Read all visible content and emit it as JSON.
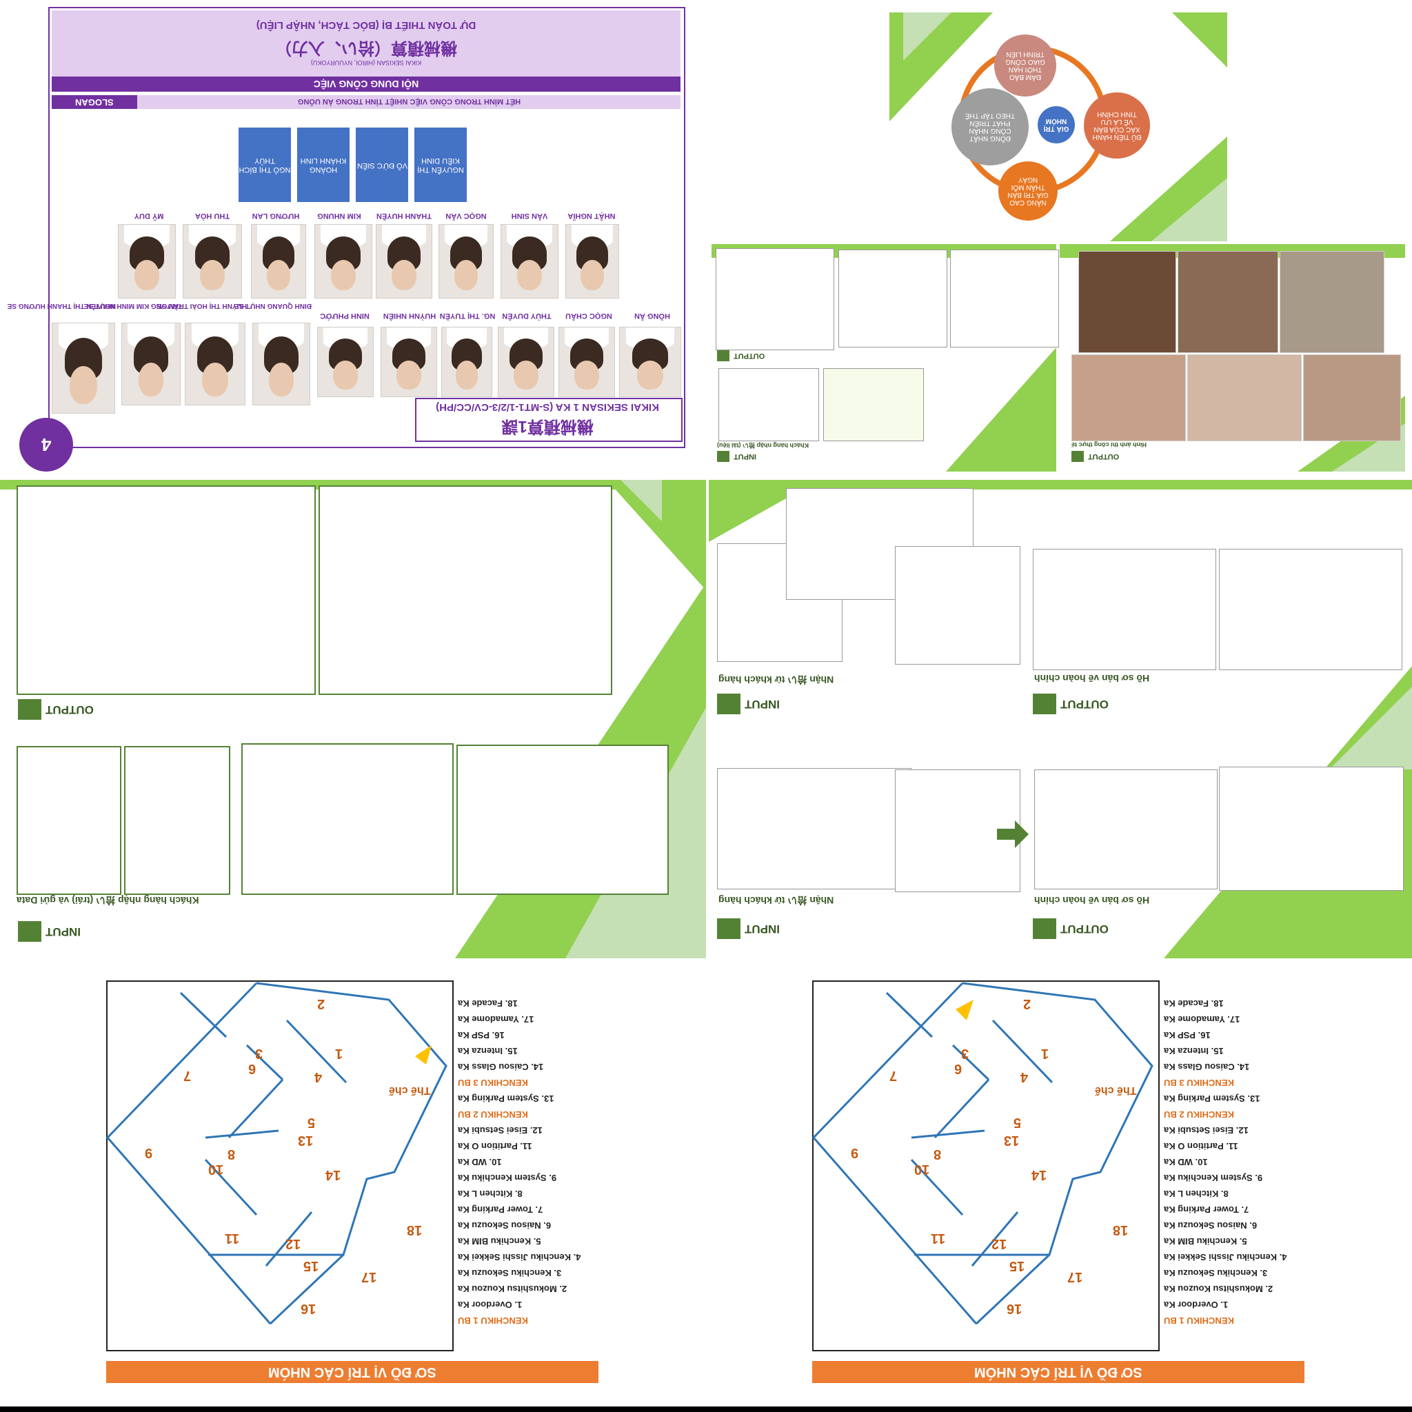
{
  "team_slide": {
    "title_vi": "DỰ TOÁN THIẾT BỊ (BÓC TÁCH, NHẬP LIỆU)",
    "title_jp": "機械積算（拾い、入力）",
    "title_romaji": "KIKAI SEKISAN (HIROI, NYUURYOKU)",
    "content_label": "NỘI DUNG CÔNG VIỆC",
    "slogan_label": "SLOGAN",
    "slogan_text": "HẾT MÌNH TRONG CÔNG VIỆC NHIỆT TÌNH TRONG ẢN UỐNG",
    "values": [
      "NGÔ THỊ BÍCH THỦY",
      "HOÀNG KHÁNH LINH",
      "VÕ ĐỨC SIÊN",
      "NGUYỄN THỊ KIỀU DINH"
    ],
    "row1_names": [
      "MỸ DUY",
      "THU HÒA",
      "HƯƠNG LAN",
      "KIM NHUNG",
      "THANH HUYỀN",
      "NGỌC VÂN",
      "VĂN SINH",
      "NHẬT NGHĨA"
    ],
    "row2_names": [
      "NGUYỄN THỊ THANH HƯƠNG SE",
      "TRƯƠNG KIM MINH NHỰT SE",
      "HUỲNH THỊ HOÀI TRÂM SE",
      "ĐINH QUANG NHỰT SE",
      "NINH PHƯỚC",
      "HUỲNH NHIÊN",
      "NG. THỊ TUYỀN",
      "THÙY DUYÊN",
      "NGỌC CHÂU",
      "HỒNG ÂN"
    ],
    "dept_jp": "機械積算1課",
    "dept_code": "KIKAI SEKISAN 1 KA (S-MT1-1/2/3-CV/CC/PH)",
    "page_number": "4",
    "purple": "#7030a0",
    "lavender": "#e2cdef",
    "blue": "#4472c4"
  },
  "cycle_slide": {
    "center": "GIÁ TRỊ NHÓM",
    "nodes": [
      "ĐẢM BẢO THỜI HẠN GIAO CÔNG TRÌNH LIÊN",
      "ĐỦ TIÊN HÀNH XÁC CỦA BẢN VẼ LÀ ƯU TINH CHỈNH",
      "NÂNG CAO GIÁ TRỊ BẢN THÂN MỖI NGÀY",
      "ĐỒNG NHẤT CÔNG NHÂN PHÁT TRIỂN THEO TẬP THỂ"
    ],
    "colors": [
      "#c9897f",
      "#d9704a",
      "#e87722",
      "#9e9e9e",
      "#4472c4"
    ]
  },
  "drawing_slide_a": {
    "output_label": "OUTPUT",
    "input_label": "INPUT",
    "input_caption": "Khách hàng nhập 拾い (tài liệu)",
    "photos_caption": "Hình ảnh thi công thực tế",
    "photos_output": "OUTPUT"
  },
  "drawing_slide_b": {
    "output_label": "OUTPUT",
    "input_label": "INPUT",
    "input_caption": "Khách hàng nhập 拾い (trái) và gửi Data"
  },
  "drawing_slide_c": {
    "input_caption_1": "Nhận 拾い từ khách hàng",
    "output_caption_1": "Hồ sơ bản vẽ hoàn chỉnh",
    "input_caption_2": "Nhận 拾い từ khách hàng",
    "output_caption_2": "Hồ sơ bản vẽ hoàn chỉnh",
    "input_label": "INPUT",
    "output_label": "OUTPUT",
    "green": "#92d050",
    "dark_green": "#548235"
  },
  "floor_map": {
    "banner": "SƠ ĐỒ VỊ TRÍ CÁC NHÓM",
    "you_are_here": "Thế chế",
    "numbers": [
      "1",
      "2",
      "3",
      "4",
      "5",
      "6",
      "7",
      "8",
      "9",
      "10",
      "11",
      "12",
      "13",
      "14",
      "15",
      "16",
      "17",
      "18"
    ],
    "legend": [
      {
        "text": "18. Facade Ka",
        "hd": false
      },
      {
        "text": "17. Yamadome Ka",
        "hd": false
      },
      {
        "text": "16. PSP Ka",
        "hd": false
      },
      {
        "text": "15. Intenza Ka",
        "hd": false
      },
      {
        "text": "14. Caisou Glass Ka",
        "hd": false
      },
      {
        "text": "KENCHIKU 3 BU",
        "hd": true
      },
      {
        "text": "13. System Parking Ka",
        "hd": false
      },
      {
        "text": "KENCHIKU 2 BU",
        "hd": true
      },
      {
        "text": "12. Eisei Setsubi Ka",
        "hd": false
      },
      {
        "text": "11. Partition O Ka",
        "hd": false
      },
      {
        "text": "10. WD Ka",
        "hd": false
      },
      {
        "text": "9. System Kenchiku Ka",
        "hd": false
      },
      {
        "text": "8. Kitchen L Ka",
        "hd": false
      },
      {
        "text": "7. Tower Parking Ka",
        "hd": false
      },
      {
        "text": "6. Naisou Sekouzu Ka",
        "hd": false
      },
      {
        "text": "5. Kenchiku BIM Ka",
        "hd": false
      },
      {
        "text": "4. Kenchiku Jisshi Sekkei Ka",
        "hd": false
      },
      {
        "text": "3. Kenchiku Sekouzu Ka",
        "hd": false
      },
      {
        "text": "2. Mokushitsu Kouzou Ka",
        "hd": false
      },
      {
        "text": "1. Overdoor Ka",
        "hd": false
      },
      {
        "text": "KENCHIKU 1 BU",
        "hd": true
      }
    ],
    "orange": "#ed7d31",
    "line_blue": "#2e75b6"
  }
}
